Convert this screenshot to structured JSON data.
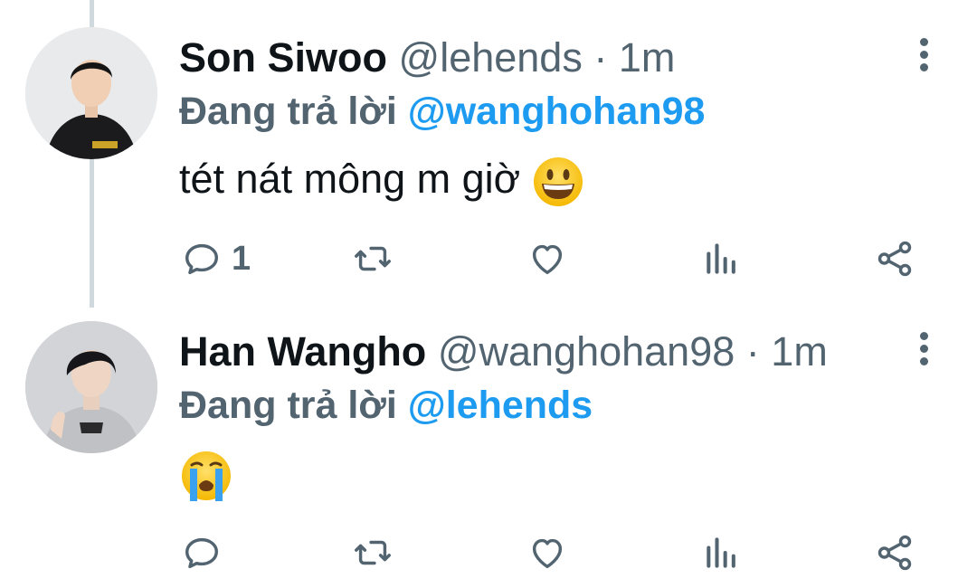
{
  "tweets": [
    {
      "name": "Son Siwoo",
      "handle": "@lehends",
      "separator": "·",
      "time": "1m",
      "replying_prefix": "Đang trả lời",
      "replying_to": "@wanghohan98",
      "text": "tét nát mông m giờ",
      "emoji": "grinning-face",
      "reply_count": "1",
      "avatar_bg": "#e6e7e9"
    },
    {
      "name": "Han Wangho",
      "handle": "@wanghohan98",
      "separator": "·",
      "time": "1m",
      "replying_prefix": "Đang trả lời",
      "replying_to": "@lehends",
      "text": "",
      "emoji": "loudly-crying-face",
      "reply_count": "",
      "avatar_bg": "#cfd1d4"
    }
  ],
  "colors": {
    "text_primary": "#0f1419",
    "text_secondary": "#536471",
    "accent": "#1d9bf0",
    "thread_line": "#cfd9de"
  },
  "icons": [
    "reply-icon",
    "retweet-icon",
    "like-icon",
    "analytics-icon",
    "share-icon",
    "more-options-icon"
  ]
}
